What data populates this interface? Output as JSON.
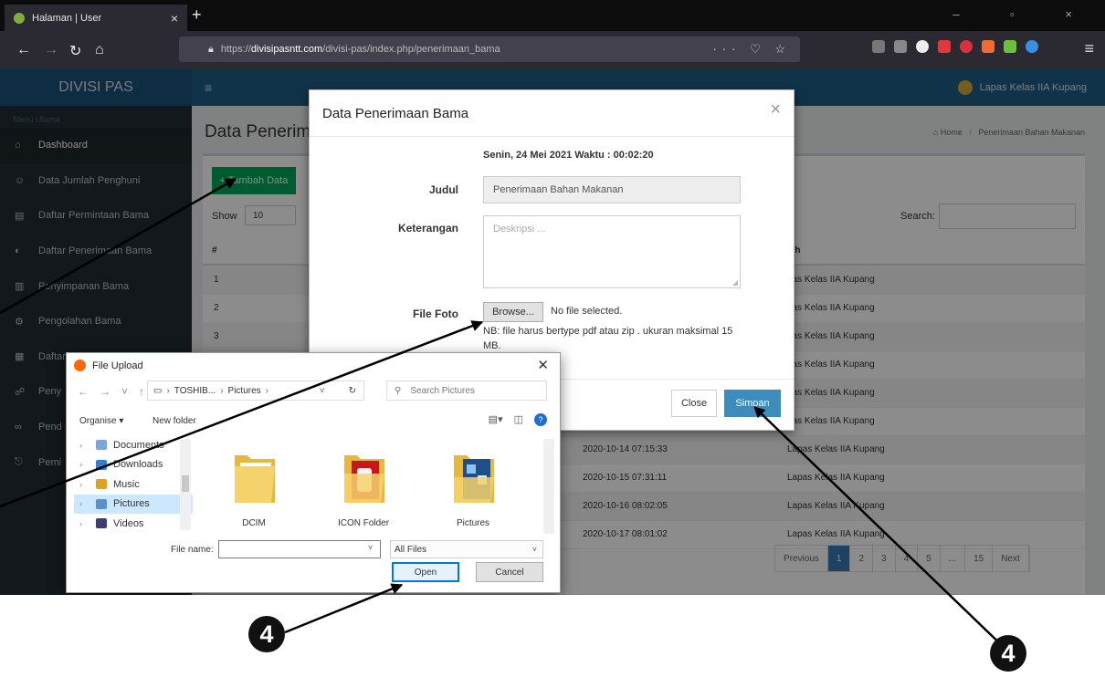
{
  "browser": {
    "tab_title": "Halaman | User",
    "tab_close": "×",
    "new_tab": "+",
    "url_prefix": "https://",
    "url_host": "divisipasntt.com",
    "url_path": "/divisi-pas/index.php/penerimaan_bama",
    "url_actions": "··· ♡ ☆",
    "window_controls": "–  ▫  ×"
  },
  "app": {
    "brand": "DIVISI PAS",
    "user_label": "Lapas Kelas IIA Kupang",
    "menu_header": "Menu Utama",
    "sidebar": [
      {
        "label": "Dashboard",
        "icon": "home-icon",
        "glyph": "⌂"
      },
      {
        "label": "Data Jumlah Penghuni",
        "icon": "users-icon",
        "glyph": "☺"
      },
      {
        "label": "Daftar Permintaan Bama",
        "icon": "doc-icon",
        "glyph": "▤"
      },
      {
        "label": "Daftar Penerimaan Bama",
        "icon": "receive-icon",
        "glyph": "◐"
      },
      {
        "label": "Penyimpanan Bama",
        "icon": "storage-icon",
        "glyph": "▥"
      },
      {
        "label": "Pengolahan Bama",
        "icon": "cog-icon",
        "glyph": "⚙"
      },
      {
        "label": "Daftar",
        "icon": "list-icon",
        "glyph": "▦"
      },
      {
        "label": "Peny",
        "icon": "share-icon",
        "glyph": "☍"
      },
      {
        "label": "Pend",
        "icon": "link-icon",
        "glyph": "∞"
      },
      {
        "label": "Pemi",
        "icon": "exit-icon",
        "glyph": "⎋"
      }
    ],
    "page_title": "Data Penerim",
    "breadcrumb_home": "Home",
    "breadcrumb_current": "Penerimaan Bahan Makanan",
    "add_button": "+ Tambah Data",
    "show_label": "Show",
    "show_value": "10",
    "search_label": "Search:",
    "table_header": {
      "c1": "#",
      "c4": "leh"
    },
    "rows": [
      {
        "no": "1",
        "time": "",
        "by": "pas Kelas IIA Kupang"
      },
      {
        "no": "2",
        "time": "",
        "by": "pas Kelas IIA Kupang"
      },
      {
        "no": "3",
        "time": "",
        "by": "pas Kelas IIA Kupang"
      },
      {
        "no": "",
        "time": "",
        "by": "pas Kelas IIA Kupang"
      },
      {
        "no": "",
        "time": "",
        "by": "pas Kelas IIA Kupang"
      },
      {
        "no": "",
        "time": "",
        "by": "pas Kelas IIA Kupang"
      },
      {
        "no": "",
        "time": "2020-10-14 07:15:33",
        "by": "Lapas Kelas IIA Kupang"
      },
      {
        "no": "",
        "time": "2020-10-15 07:31:11",
        "by": "Lapas Kelas IIA Kupang"
      },
      {
        "no": "",
        "time": "2020-10-16 08:02:05",
        "by": "Lapas Kelas IIA Kupang"
      },
      {
        "no": "",
        "time": "2020-10-17 08:01:02",
        "by": "Lapas Kelas IIA Kupang"
      }
    ],
    "pagination": [
      "Previous",
      "1",
      "2",
      "3",
      "4",
      "5",
      "...",
      "15",
      "Next"
    ]
  },
  "modal": {
    "title": "Data Penerimaan Bama",
    "close_x": "×",
    "date_line": "Senin, 24 Mei 2021  Waktu : 00:02:20",
    "judul_label": "Judul",
    "judul_value": "Penerimaan Bahan Makanan",
    "keterangan_label": "Keterangan",
    "keterangan_placeholder": "Deskripsi ...",
    "file_label": "File Foto",
    "browse_label": "Browse...",
    "no_file": "No file selected.",
    "file_note": "NB: file harus bertype pdf atau zip . ukuran maksimal 15 MB.",
    "close_button": "Close",
    "save_button": "Simpan"
  },
  "file_dialog": {
    "title": "File Upload",
    "close_x": "✕",
    "path": [
      "TOSHIB...",
      "Pictures"
    ],
    "search_placeholder": "Search Pictures",
    "organise": "Organise ▾",
    "new_folder": "New folder",
    "tree": [
      "Documents",
      "Downloads",
      "Music",
      "Pictures",
      "Videos"
    ],
    "files": [
      "DCIM",
      "ICON Folder",
      "Pictures"
    ],
    "filename_label": "File name:",
    "filetype": "All Files",
    "open_button": "Open",
    "cancel_button": "Cancel"
  },
  "annotations": {
    "step_left": "4",
    "step_right": "4"
  }
}
